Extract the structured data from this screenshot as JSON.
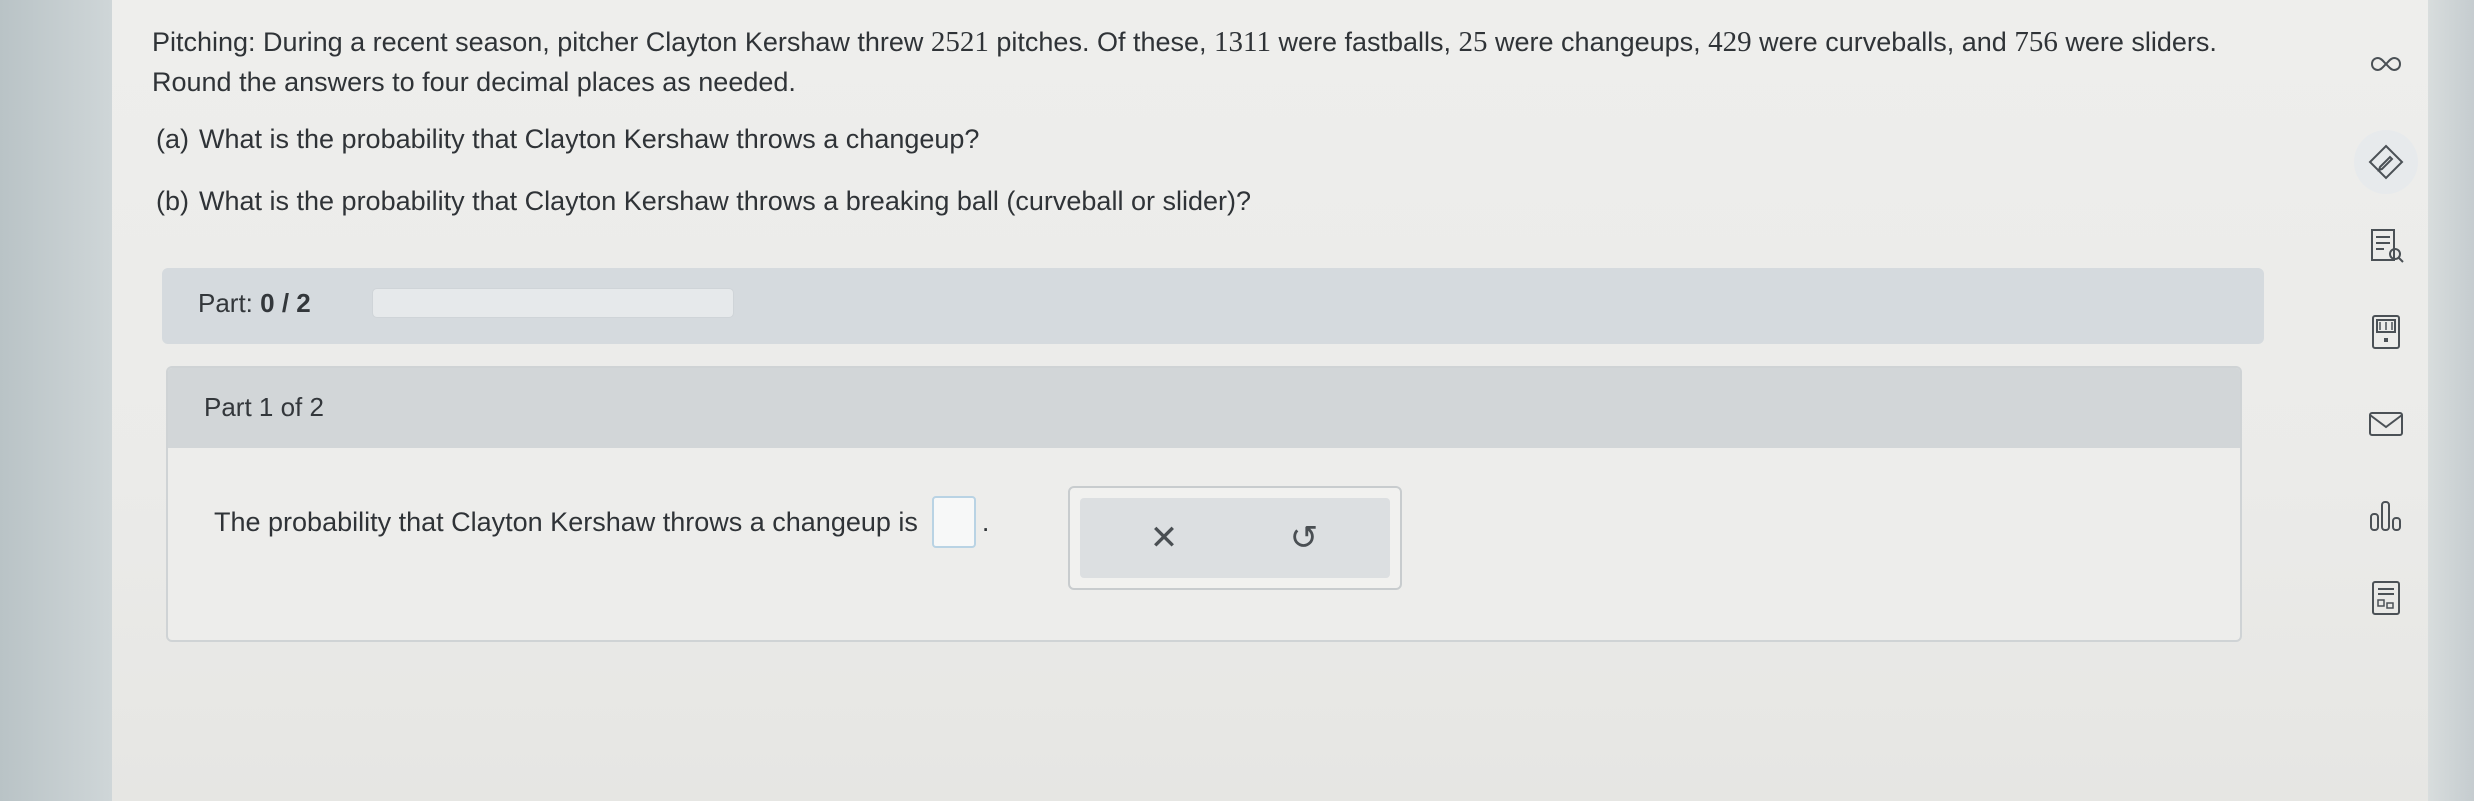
{
  "question": {
    "seg1": "Pitching: During a recent season, pitcher Clayton Kershaw threw ",
    "n_total": "2521",
    "seg2": " pitches. Of these, ",
    "n_fast": "1311",
    "seg3": " were fastballs, ",
    "n_change": "25",
    "seg4": " were changeups, ",
    "n_curve": "429",
    "seg5": " were curveballs, and ",
    "n_slider": "756",
    "seg6": " were sliders. Round the answers to four decimal places as needed.",
    "part_a_label": "(a)",
    "part_a_text": "What is the probability that Clayton Kershaw throws a changeup?",
    "part_b_label": "(b)",
    "part_b_text": "What is the probability that Clayton Kershaw throws a breaking ball (curveball or slider)?"
  },
  "progress": {
    "label": "Part:",
    "value": "0 / 2",
    "fraction": 0
  },
  "part_card": {
    "header": "Part 1 of 2",
    "answer_prefix": "The probability that Clayton Kershaw throws a changeup is",
    "answer_suffix": ".",
    "answer_value": ""
  },
  "tools": {
    "clear_symbol": "✕",
    "undo_symbol": "↺"
  },
  "sidebar": {
    "icons": [
      "infinity-icon",
      "pencil-diamond-icon",
      "notes-search-icon",
      "calculator-icon",
      "mail-icon",
      "bar-chart-icon",
      "list-icon"
    ]
  }
}
